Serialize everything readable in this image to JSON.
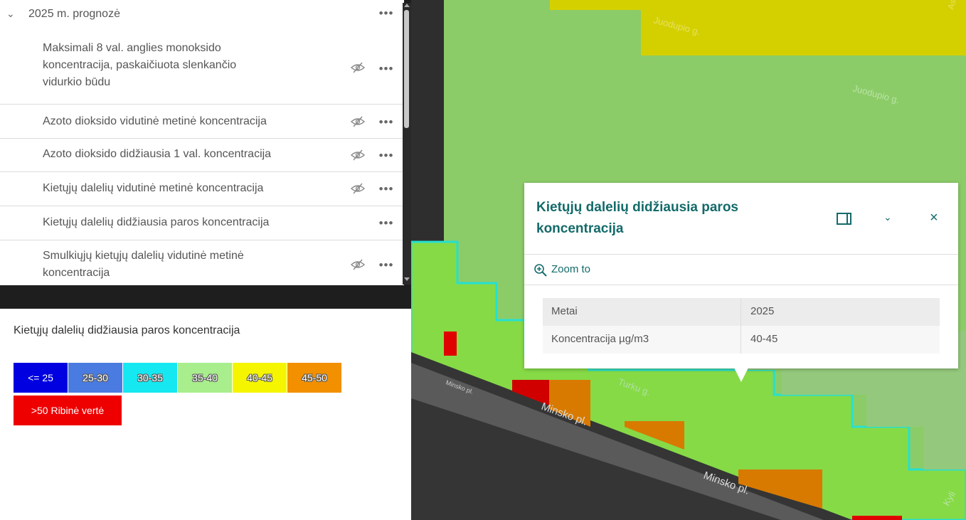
{
  "layer_list": {
    "group": {
      "title": "2025 m. prognozė",
      "expanded": true
    },
    "layers": [
      {
        "label_lines": [
          "Maksimali 8 val. anglies monoksido",
          "koncentracija, paskaičiuota slenkančio",
          "vidurkio būdu"
        ],
        "hidden": true
      },
      {
        "label_lines": [
          "Azoto dioksido vidutinė metinė koncentracija"
        ],
        "hidden": true
      },
      {
        "label_lines": [
          "Azoto dioksido didžiausia 1 val. koncentracija"
        ],
        "hidden": true
      },
      {
        "label_lines": [
          "Kietųjų dalelių vidutinė metinė koncentracija"
        ],
        "hidden": true
      },
      {
        "label_lines": [
          "Kietųjų dalelių didžiausia paros koncentracija"
        ],
        "hidden": false
      },
      {
        "label_lines": [
          "Smulkiųjų kietųjų dalelių vidutinė metinė",
          "koncentracija"
        ],
        "hidden": true
      }
    ],
    "options_glyph": "•••"
  },
  "legend": {
    "title": "Kietųjų dalelių didžiausia paros koncentracija",
    "classes": [
      {
        "label": "<= 25",
        "color": "#0000e0"
      },
      {
        "label": "25-30",
        "color": "#4a7be0"
      },
      {
        "label": "30-35",
        "color": "#15e8f0"
      },
      {
        "label": "35-40",
        "color": "#a8ee8c"
      },
      {
        "label": "40-45",
        "color": "#f5f500"
      },
      {
        "label": "45-50",
        "color": "#f29000"
      },
      {
        "label": ">50 Ribinė vertė",
        "color": "#ee0000"
      }
    ]
  },
  "map": {
    "street_labels": [
      "Juodupio g.",
      "Juodupio g.",
      "Minsko pl.",
      "Minsko pl.",
      "Minsko pl.",
      "Turku g.",
      "Astr",
      "Kyli"
    ]
  },
  "popup": {
    "title_lines": [
      "Kietųjų dalelių didžiausia paros",
      "koncentracija"
    ],
    "zoom_label": "Zoom to",
    "attributes": [
      {
        "key": "Metai",
        "value": "2025"
      },
      {
        "key": "Koncentracija µg/m3",
        "value": "40-45"
      }
    ]
  }
}
